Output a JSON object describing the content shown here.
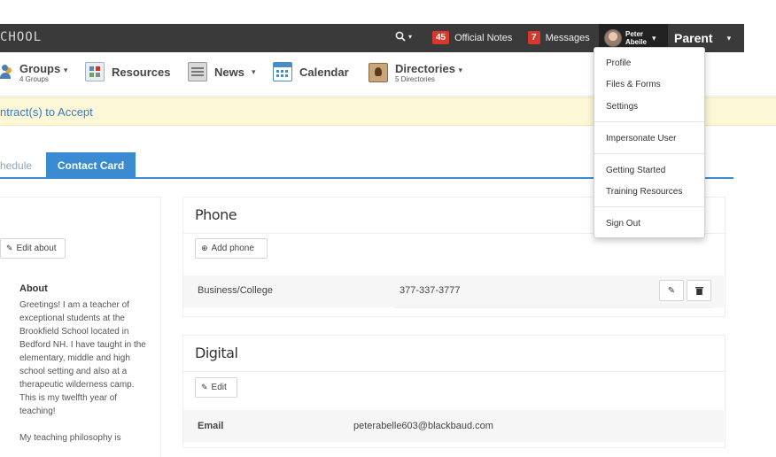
{
  "topbar": {
    "logo": "CHOOL",
    "search_caret": "▾",
    "notes": {
      "count": "45",
      "label": "Official Notes"
    },
    "messages": {
      "count": "7",
      "label": "Messages"
    },
    "user": {
      "first": "Peter",
      "last": "Abeile"
    },
    "role": "Parent"
  },
  "nav": {
    "groups": {
      "label": "Groups",
      "sub": "4 Groups"
    },
    "resources": {
      "label": "Resources"
    },
    "news": {
      "label": "News"
    },
    "calendar": {
      "label": "Calendar"
    },
    "directories": {
      "label": "Directories",
      "sub": "5 Directories"
    }
  },
  "alert": {
    "text": "ntract(s) to Accept"
  },
  "tabs": [
    {
      "label": "hedule"
    },
    {
      "label": "Contact Card"
    }
  ],
  "left": {
    "edit_about": "Edit about",
    "about_heading": "About",
    "about_text": "Greetings! I am a teacher of exceptional students at the Brookfield School located in Bedford NH. I have taught in the elementary, middle and high school setting and also at a therapeutic wilderness camp. This is my twelfth year of teaching!\n\nMy teaching philosophy is"
  },
  "phone": {
    "title": "Phone",
    "add_label": "Add phone",
    "rows": [
      {
        "type": "Business/College",
        "number": "377-337-3777"
      }
    ]
  },
  "digital": {
    "title": "Digital",
    "edit_label": "Edit",
    "rows": [
      {
        "type": "Email",
        "value": "peterabelle603@blackbaud.com"
      }
    ]
  },
  "dropdown": {
    "items": [
      "Profile",
      "Files & Forms",
      "Settings",
      "Impersonate User",
      "Getting Started",
      "Training Resources",
      "Sign Out"
    ]
  },
  "colors": {
    "topbar": "#3a3a3a",
    "accent_blue": "#3a8bd2",
    "badge_red": "#d9372b",
    "alert_bg": "#fcf7d7"
  }
}
